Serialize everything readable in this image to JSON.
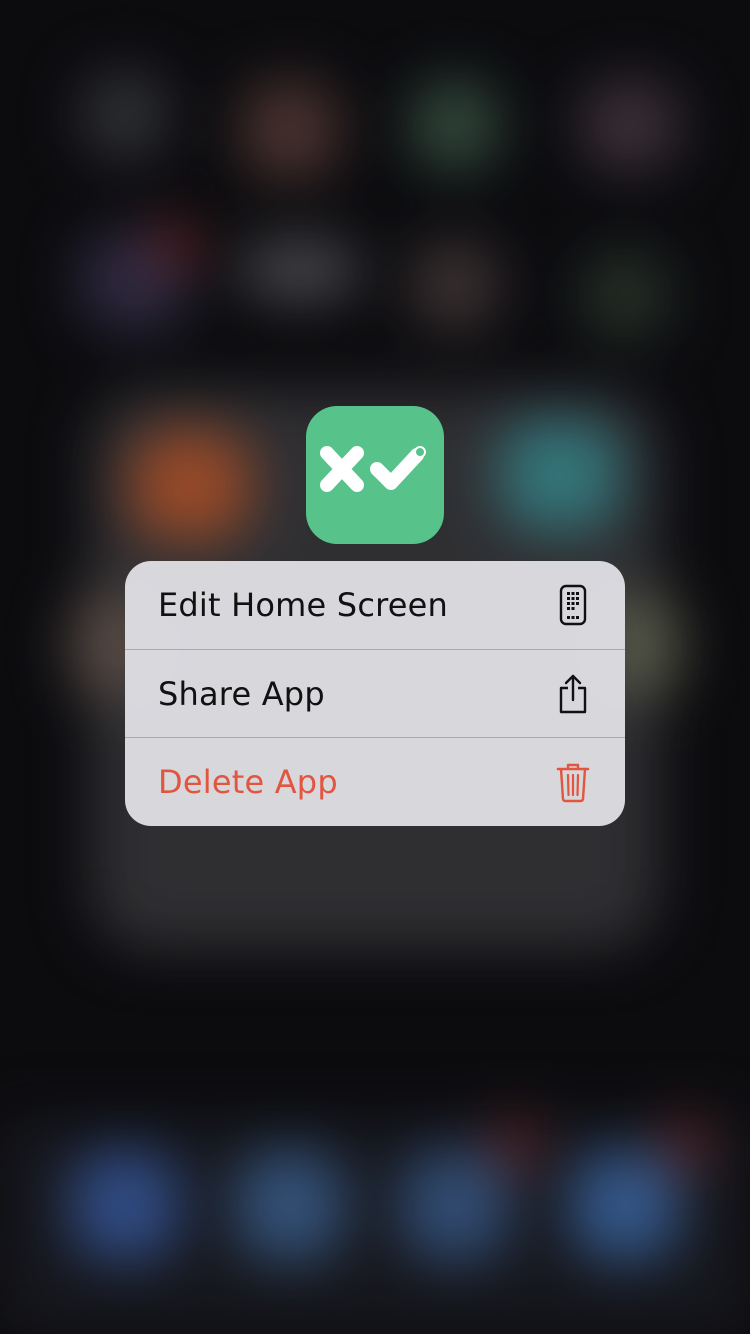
{
  "app": {
    "icon_name": "x-check-app-icon",
    "icon_color": "#57c38b"
  },
  "context_menu": {
    "items": [
      {
        "label": "Edit Home Screen",
        "icon": "phone-apps-icon",
        "destructive": false
      },
      {
        "label": "Share App",
        "icon": "share-icon",
        "destructive": false
      },
      {
        "label": "Delete App",
        "icon": "trash-icon",
        "destructive": true
      }
    ],
    "colors": {
      "text": "#111111",
      "destructive": "#e2553f",
      "background": "#e4e4e9"
    }
  }
}
